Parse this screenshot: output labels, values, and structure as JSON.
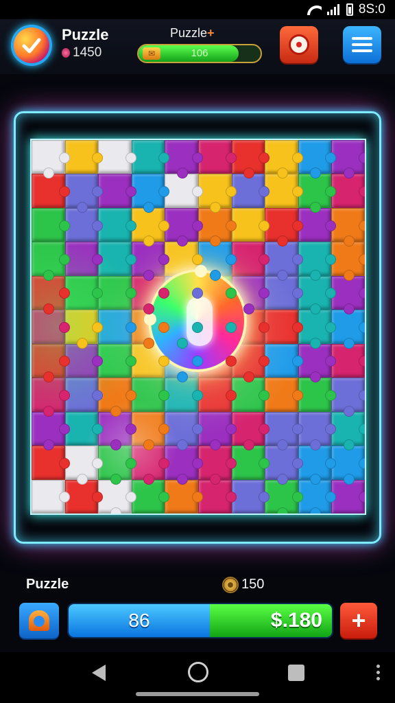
{
  "status_bar": {
    "time": "8S:0"
  },
  "header": {
    "title": "Puzzle",
    "coins": "1450",
    "level_label": "Puzzle",
    "level_mark": "+",
    "progress_value": "106",
    "progress_fraction": 0.82
  },
  "board": {
    "rows": 11,
    "cols": 10,
    "palette": [
      "#e8302d",
      "#1f9be8",
      "#f7c21b",
      "#2dc44a",
      "#9b2fbf",
      "#e9e9ee",
      "#f07a18",
      "#d6246f",
      "#19b3b0",
      "#6d6fd8"
    ]
  },
  "footer": {
    "title": "Puzzle",
    "gem_count": "150",
    "left_value": "86",
    "right_value": "$.180",
    "plus_label": "+"
  },
  "colors": {
    "frame_glow": "#7fe9ff",
    "progress_green": "#36e22e",
    "button_blue": "#1a8cf0",
    "button_red": "#e0331c"
  }
}
